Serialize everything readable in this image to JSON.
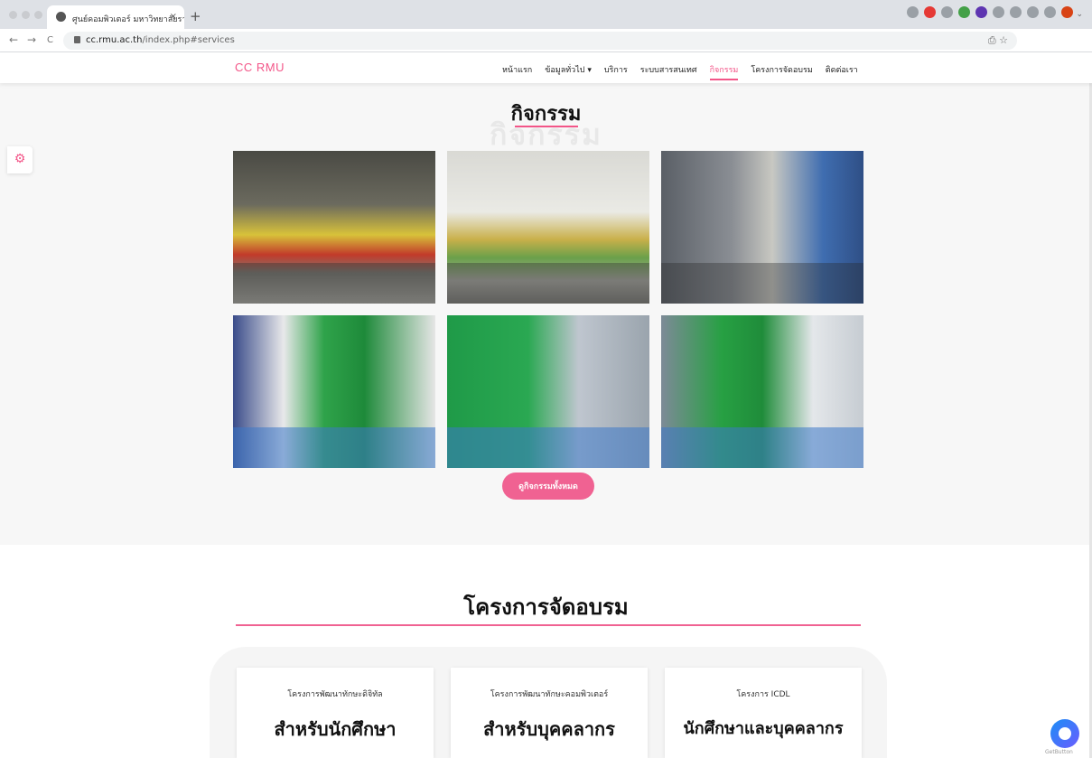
{
  "browser": {
    "tab_title": "ศูนย์คอมพิวเตอร์ มหาวิทยาลัยราชภั",
    "tab_close": "×",
    "new_tab": "+",
    "tab_menu": "⌄",
    "back": "←",
    "forward": "→",
    "reload": "C",
    "url_host": "cc.rmu.ac.th",
    "url_path": "/index.php#services",
    "omni_icons": "⎙ ☆"
  },
  "header": {
    "logo": "CC RMU",
    "nav": [
      {
        "label": "หน้าแรก"
      },
      {
        "label": "ข้อมูลทั่วไป ▾"
      },
      {
        "label": "บริการ"
      },
      {
        "label": "ระบบสารสนเทศ"
      },
      {
        "label": "กิจกรรม"
      },
      {
        "label": "โครงการจัดอบรม"
      },
      {
        "label": "ติดต่อเรา"
      }
    ]
  },
  "activities": {
    "title": "กิจกรรม",
    "bg_title": "กิจกรรม",
    "view_all": "ดูกิจกรรมทั้งหมด",
    "settings_icon": "⚙"
  },
  "training": {
    "title": "โครงการจัดอบรม",
    "cards": [
      {
        "caption": "โครงการพัฒนาทักษะดิจิทัล",
        "big": "สำหรับนักศึกษา"
      },
      {
        "caption": "โครงการพัฒนาทักษะคอมพิวเตอร์",
        "big": "สำหรับบุคคลากร"
      },
      {
        "caption": "โครงการ ICDL",
        "big": "นักศึกษาและบุคคลากร"
      }
    ]
  },
  "widget": {
    "getbutton": "GetButton"
  },
  "colors": {
    "accent": "#f35588",
    "button": "#f06292"
  }
}
